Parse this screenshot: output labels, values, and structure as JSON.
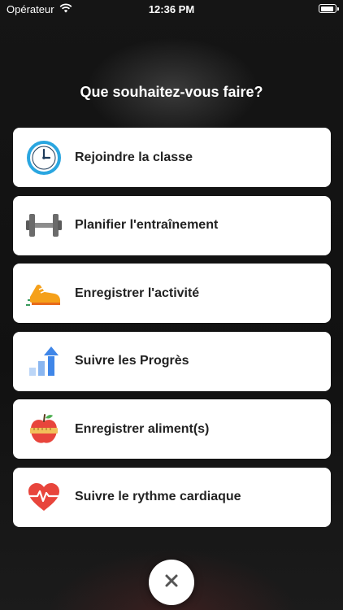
{
  "status": {
    "carrier": "Opérateur",
    "time": "12:36 PM"
  },
  "title": "Que souhaitez-vous faire?",
  "actions": [
    {
      "label": "Rejoindre la classe",
      "icon": "clock-icon"
    },
    {
      "label": "Planifier l'entraînement",
      "icon": "dumbbell-icon"
    },
    {
      "label": "Enregistrer l'activité",
      "icon": "running-shoe-icon"
    },
    {
      "label": "Suivre les Progrès",
      "icon": "progress-chart-icon"
    },
    {
      "label": "Enregistrer aliment(s)",
      "icon": "apple-icon"
    },
    {
      "label": "Suivre le rythme cardiaque",
      "icon": "heart-rate-icon"
    }
  ],
  "close_icon": "close-icon"
}
